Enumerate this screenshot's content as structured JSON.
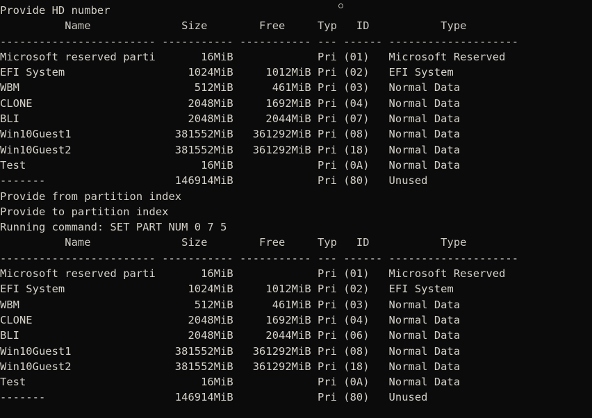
{
  "terminal": {
    "background_color": "#0b0b0c",
    "text_color": "#d6d2c8",
    "columns": {
      "name_width": 24,
      "size_width": 11,
      "free_width": 11,
      "typ_width": 3,
      "id_width": 6,
      "type_width": 20
    },
    "header": {
      "name": "Name",
      "size": "Size",
      "free": "Free",
      "typ": "Typ",
      "id": "ID",
      "type": "Type"
    },
    "separator": "------------------------ ----------- ----------- --- ------ --------------------",
    "prompts": {
      "provide_hd_number": "Provide HD number",
      "provide_from_partition_index": "Provide from partition index",
      "provide_to_partition_index": "Provide to partition index",
      "running_command": "Running command: SET PART NUM 0 7 5"
    },
    "pointer_icon": "mouse-pointer-dot",
    "tables": [
      {
        "id": "partition-table-before",
        "rows": [
          {
            "name": "Microsoft reserved parti",
            "size": "16MiB",
            "free": "",
            "typ": "Pri",
            "part_id": "(01)",
            "type": "Microsoft Reserved"
          },
          {
            "name": "EFI System",
            "size": "1024MiB",
            "free": "1012MiB",
            "typ": "Pri",
            "part_id": "(02)",
            "type": "EFI System"
          },
          {
            "name": "WBM",
            "size": "512MiB",
            "free": "461MiB",
            "typ": "Pri",
            "part_id": "(03)",
            "type": "Normal Data"
          },
          {
            "name": "CLONE",
            "size": "2048MiB",
            "free": "1692MiB",
            "typ": "Pri",
            "part_id": "(04)",
            "type": "Normal Data"
          },
          {
            "name": "BLI",
            "size": "2048MiB",
            "free": "2044MiB",
            "typ": "Pri",
            "part_id": "(07)",
            "type": "Normal Data"
          },
          {
            "name": "Win10Guest1",
            "size": "381552MiB",
            "free": "361292MiB",
            "typ": "Pri",
            "part_id": "(08)",
            "type": "Normal Data"
          },
          {
            "name": "Win10Guest2",
            "size": "381552MiB",
            "free": "361292MiB",
            "typ": "Pri",
            "part_id": "(18)",
            "type": "Normal Data"
          },
          {
            "name": "Test",
            "size": "16MiB",
            "free": "",
            "typ": "Pri",
            "part_id": "(0A)",
            "type": "Normal Data"
          },
          {
            "name": "-------",
            "size": "146914MiB",
            "free": "",
            "typ": "Pri",
            "part_id": "(80)",
            "type": "Unused"
          }
        ]
      },
      {
        "id": "partition-table-after",
        "rows": [
          {
            "name": "Microsoft reserved parti",
            "size": "16MiB",
            "free": "",
            "typ": "Pri",
            "part_id": "(01)",
            "type": "Microsoft Reserved"
          },
          {
            "name": "EFI System",
            "size": "1024MiB",
            "free": "1012MiB",
            "typ": "Pri",
            "part_id": "(02)",
            "type": "EFI System"
          },
          {
            "name": "WBM",
            "size": "512MiB",
            "free": "461MiB",
            "typ": "Pri",
            "part_id": "(03)",
            "type": "Normal Data"
          },
          {
            "name": "CLONE",
            "size": "2048MiB",
            "free": "1692MiB",
            "typ": "Pri",
            "part_id": "(04)",
            "type": "Normal Data"
          },
          {
            "name": "BLI",
            "size": "2048MiB",
            "free": "2044MiB",
            "typ": "Pri",
            "part_id": "(06)",
            "type": "Normal Data"
          },
          {
            "name": "Win10Guest1",
            "size": "381552MiB",
            "free": "361292MiB",
            "typ": "Pri",
            "part_id": "(08)",
            "type": "Normal Data"
          },
          {
            "name": "Win10Guest2",
            "size": "381552MiB",
            "free": "361292MiB",
            "typ": "Pri",
            "part_id": "(18)",
            "type": "Normal Data"
          },
          {
            "name": "Test",
            "size": "16MiB",
            "free": "",
            "typ": "Pri",
            "part_id": "(0A)",
            "type": "Normal Data"
          },
          {
            "name": "-------",
            "size": "146914MiB",
            "free": "",
            "typ": "Pri",
            "part_id": "(80)",
            "type": "Unused"
          }
        ]
      }
    ]
  }
}
